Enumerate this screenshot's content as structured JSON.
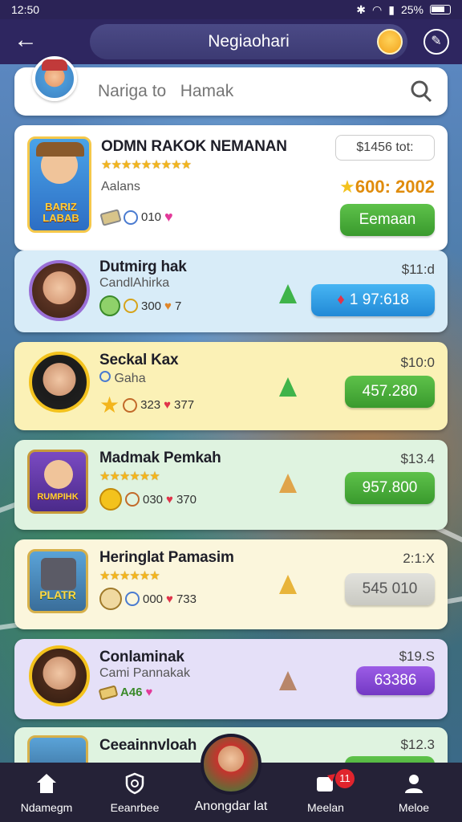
{
  "status": {
    "time": "12:50",
    "battery": "25%"
  },
  "header": {
    "title": "Negiaohari"
  },
  "search": {
    "placeholder": "Nariga to   Hamak"
  },
  "featured": {
    "name": "ODMN RAKOK NEMANAN",
    "rating_stars": 9,
    "sub": "Aalans",
    "price": "$1456 tot:",
    "reward": "600: 2002",
    "stat1": "010",
    "button": "Eemaan",
    "thumb_text": "BARIZ LABAB"
  },
  "rows": [
    {
      "name": "Dutmirg hak",
      "sub": "CandlAhirka",
      "price": "$11:d",
      "stat1": "300",
      "stat2": "7",
      "button": "1    97:618",
      "style": "blue",
      "bg": "#d8ecf8"
    },
    {
      "name": "Seckal Kax",
      "sub": "Gaha",
      "price": "$10:0",
      "stat1": "323",
      "stat2": "377",
      "button": "457.280",
      "style": "green",
      "bg": "#fbf1b6"
    },
    {
      "name": "Madmak Pemkah",
      "sub": "",
      "price": "$13.4",
      "stat1": "030",
      "stat2": "370",
      "button": "957.800",
      "style": "green",
      "bg": "#dff3e0",
      "thumb_text": "RUMPIHK"
    },
    {
      "name": "Heringlat Pamasim",
      "sub": "",
      "price": "2:1:X",
      "stat1": "000",
      "stat2": "733",
      "button": "545 010",
      "style": "grey",
      "bg": "#fbf6dc",
      "thumb_text": "PLATR"
    },
    {
      "name": "Conlaminak",
      "sub": "Cami Pannakak",
      "price": "$19.S",
      "stat1": "A46",
      "stat2": "",
      "button": "63386",
      "style": "purple",
      "bg": "#e5e0f8"
    },
    {
      "name": "Ceeainnvloah",
      "sub": "",
      "price": "$12.3",
      "bg": "#dff3e0"
    }
  ],
  "nav": {
    "items": [
      {
        "label": "Ndamegm",
        "icon": "home-icon"
      },
      {
        "label": "Eeanrbee",
        "icon": "shield-icon"
      },
      {
        "label": "Anongdar lat",
        "icon": "profile-avatar"
      },
      {
        "label": "Meelan",
        "icon": "chat-icon",
        "badge": "11"
      },
      {
        "label": "Meloe",
        "icon": "person-icon"
      }
    ]
  }
}
